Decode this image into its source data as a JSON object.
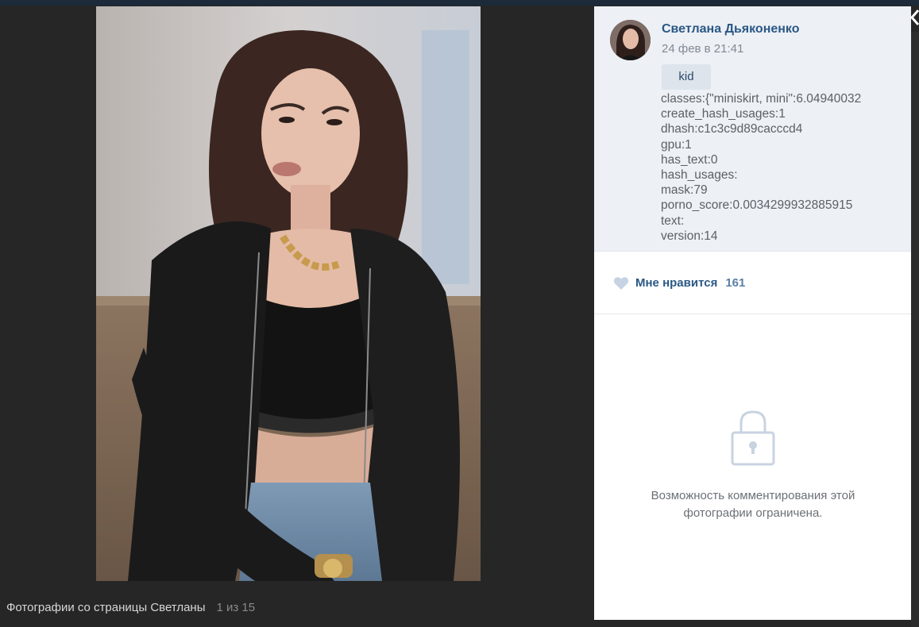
{
  "caption": {
    "album": "Фотографии со страницы Светланы",
    "counter": "1 из 15"
  },
  "post": {
    "author": "Светлана Дьяконенко",
    "date": "24 фев в 21:41",
    "tag": "kid",
    "meta_lines": [
      "classes:{\"miniskirt, mini\":6.04940032",
      "create_hash_usages:1",
      "dhash:c1c3c9d89cacccd4",
      "gpu:1",
      "has_text:0",
      "hash_usages:",
      "mask:79",
      "porno_score:0.0034299932885915",
      "text:",
      "version:14"
    ]
  },
  "likes": {
    "label": "Мне нравится",
    "count": "161"
  },
  "comments": {
    "restricted_text": "Возможность комментирования этой фотографии ограничена."
  },
  "icons": {
    "like": "heart-icon",
    "lock": "lock-icon",
    "close": "chevron-left-icon"
  },
  "colors": {
    "link": "#2a5885",
    "panel_top": "#edf0f5",
    "background": "#262626"
  }
}
